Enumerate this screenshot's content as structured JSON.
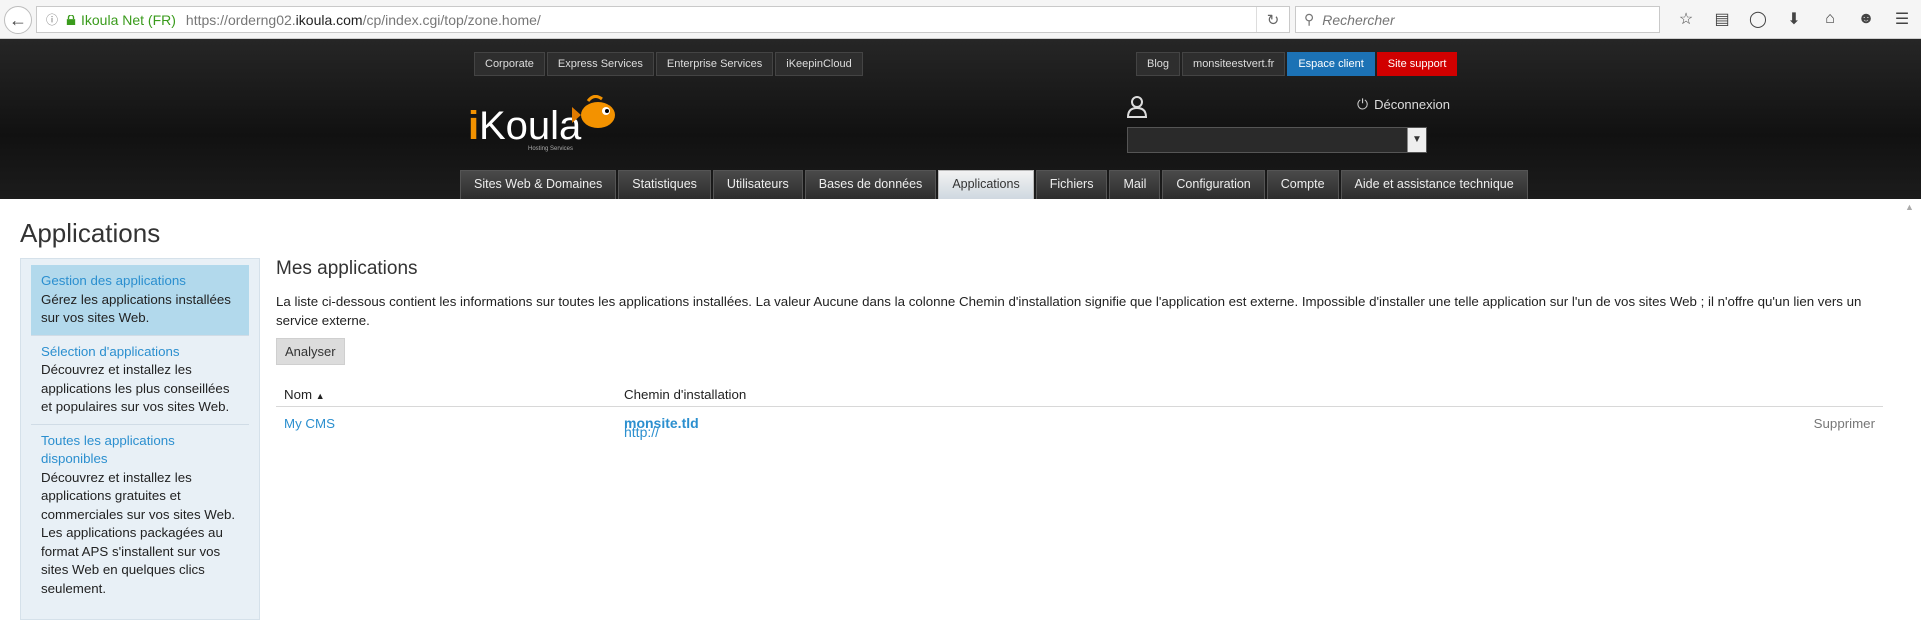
{
  "browser": {
    "site_identity": "Ikoula Net (FR)",
    "url_prefix": "https://orderng02.",
    "url_domain": "ikoula.com",
    "url_path": "/cp/index.cgi/top/zone.home/",
    "search_placeholder": "Rechercher"
  },
  "topnav_left": [
    "Corporate",
    "Express Services",
    "Enterprise Services",
    "iKeepinCloud"
  ],
  "topnav_right": {
    "blog": "Blog",
    "monsite": "monsiteestvert.fr",
    "espace_client": "Espace client",
    "site_support": "Site support"
  },
  "header": {
    "logout": "Déconnexion",
    "logo_text": "iKoula",
    "logo_tagline": "Hosting Services"
  },
  "mainnav": [
    {
      "label": "Sites Web & Domaines",
      "active": false
    },
    {
      "label": "Statistiques",
      "active": false
    },
    {
      "label": "Utilisateurs",
      "active": false
    },
    {
      "label": "Bases de données",
      "active": false
    },
    {
      "label": "Applications",
      "active": true
    },
    {
      "label": "Fichiers",
      "active": false
    },
    {
      "label": "Mail",
      "active": false
    },
    {
      "label": "Configuration",
      "active": false
    },
    {
      "label": "Compte",
      "active": false
    },
    {
      "label": "Aide et assistance technique",
      "active": false
    }
  ],
  "page": {
    "title": "Applications"
  },
  "sidebar": {
    "items": [
      {
        "link": "Gestion des applications",
        "desc": "Gérez les applications installées sur vos sites Web.",
        "active": true
      },
      {
        "link": "Sélection d'applications",
        "desc": "Découvrez et installez les applications les plus conseillées et populaires sur vos sites Web.",
        "active": false
      },
      {
        "link": "Toutes les applications disponibles",
        "desc": "Découvrez et installez les applications gratuites et commerciales sur vos sites Web. Les applications packagées au format APS s'installent sur vos sites Web en quelques clics seulement.",
        "active": false
      }
    ]
  },
  "main": {
    "heading": "Mes applications",
    "intro": "La liste ci-dessous contient les informations sur toutes les applications installées. La valeur Aucune dans la colonne Chemin d'installation signifie que l'application est externe. Impossible d'installer une telle application sur l'un de vos sites Web ; il n'offre qu'un lien vers un service externe.",
    "analyze_button": "Analyser",
    "table": {
      "col_name": "Nom",
      "col_path": "Chemin d'installation",
      "rows": [
        {
          "name": "My CMS",
          "path_prefix": "http://",
          "path_host": "monsite.tld",
          "action": "Supprimer"
        }
      ]
    }
  },
  "colors": {
    "link": "#2b8fcf",
    "espace_client": "#1c72b5",
    "site_support": "#d10000",
    "sidebar_bg": "#e8f0f6",
    "sidebar_active": "#b2d9ec"
  }
}
